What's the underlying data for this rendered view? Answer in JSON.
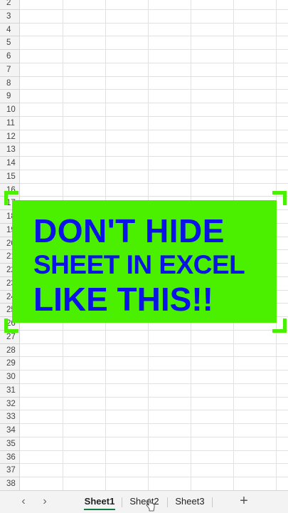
{
  "rows": [
    "2",
    "3",
    "4",
    "5",
    "6",
    "7",
    "8",
    "9",
    "10",
    "11",
    "12",
    "13",
    "14",
    "15",
    "16",
    "17",
    "18",
    "19",
    "20",
    "21",
    "22",
    "23",
    "24",
    "25",
    "26",
    "27",
    "28",
    "29",
    "30",
    "31",
    "32",
    "33",
    "34",
    "35",
    "36",
    "37",
    "38"
  ],
  "banner": {
    "line1": "DON'T HIDE",
    "line2": "SHEET IN EXCEL",
    "line3": "LIKE THIS!!",
    "text_color": "#0a14e6",
    "background_color": "#4bef00"
  },
  "tabs": {
    "prev_icon": "chevron-left-icon",
    "next_icon": "chevron-right-icon",
    "sheet1": "Sheet1",
    "sheet2": "Sheet2",
    "sheet3": "Sheet3",
    "add_icon": "plus-icon",
    "active": "Sheet1",
    "accent_color": "#107c41"
  }
}
